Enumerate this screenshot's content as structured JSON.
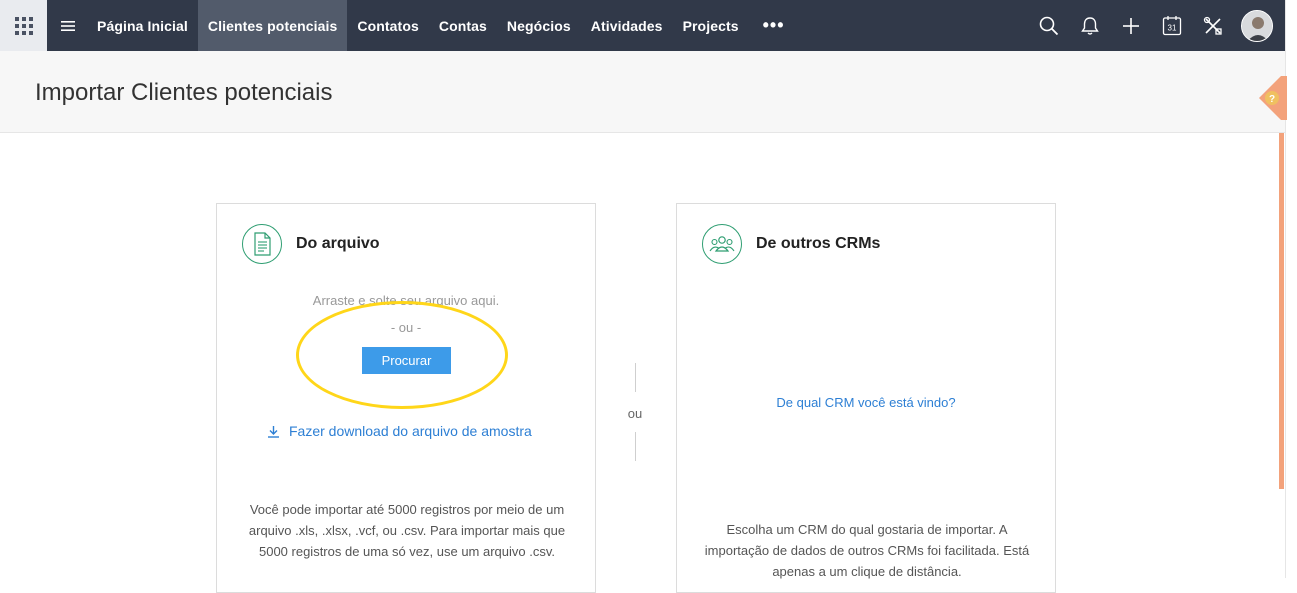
{
  "nav": {
    "items": [
      {
        "label": "Página Inicial",
        "active": false
      },
      {
        "label": "Clientes potenciais",
        "active": true
      },
      {
        "label": "Contatos",
        "active": false
      },
      {
        "label": "Contas",
        "active": false
      },
      {
        "label": "Negócios",
        "active": false
      },
      {
        "label": "Atividades",
        "active": false
      },
      {
        "label": "Projects",
        "active": false
      }
    ],
    "more_label": "•••",
    "icons": [
      "apps-grid-icon",
      "hamburger-menu-icon",
      "search-icon",
      "bell-icon",
      "plus-icon",
      "calendar-icon",
      "tools-icon"
    ],
    "calendar_day": "31"
  },
  "page": {
    "title": "Importar Clientes potenciais",
    "help_label": "?"
  },
  "from_file": {
    "title": "Do arquivo",
    "drop_text": "Arraste e solte seu arquivo aqui.",
    "or_text": "-   ou   -",
    "browse_label": "Procurar",
    "download_label": "Fazer download do arquivo de amostra",
    "description": "Você pode importar até 5000 registros por meio de um arquivo .xls, .xlsx, .vcf, ou .csv. Para importar mais que 5000 registros de uma só vez, use um arquivo .csv."
  },
  "separator": {
    "label": "ou"
  },
  "from_crm": {
    "title": "De outros CRMs",
    "question_link": "De qual CRM você está vindo?",
    "description": "Escolha um CRM do qual gostaria de importar. A importação de dados de outros CRMs foi facilitada. Está apenas a um clique de distância."
  },
  "colors": {
    "topbar": "#313949",
    "active_tab": "#525b6b",
    "accent_blue": "#3d9be9",
    "link_blue": "#2d7fd4",
    "icon_green": "#2f9e72",
    "highlight_yellow": "#ffd619",
    "help_orange": "#f3a27b"
  }
}
